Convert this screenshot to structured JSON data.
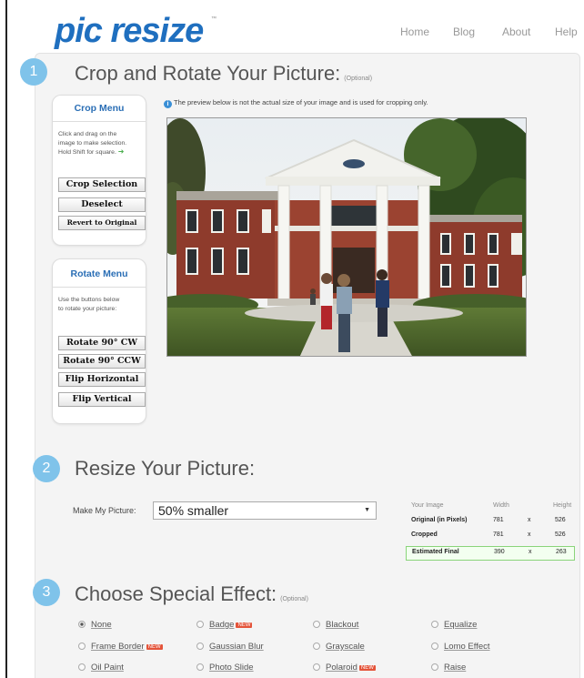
{
  "header": {
    "logo": "pic resize",
    "nav": [
      "Home",
      "Blog",
      "About",
      "Help"
    ]
  },
  "steps": [
    {
      "number": "1",
      "title": "Crop and Rotate Your Picture:",
      "optional": "(Optional)"
    },
    {
      "number": "2",
      "title": "Resize Your Picture:",
      "optional": ""
    },
    {
      "number": "3",
      "title": "Choose Special Effect:",
      "optional": "(Optional)"
    }
  ],
  "crop_menu": {
    "title": "Crop Menu",
    "desc_line1": "Click and drag on the",
    "desc_line2": "image to make selection.",
    "desc_line3": "Hold Shift for square.",
    "buttons": [
      "Crop Selection",
      "Deselect",
      "Revert to Original"
    ]
  },
  "rotate_menu": {
    "title": "Rotate Menu",
    "desc_line1": "Use the buttons below",
    "desc_line2": "to rotate your picture:",
    "buttons": [
      "Rotate 90° CW",
      "Rotate 90° CCW",
      "Flip Horizontal",
      "Flip Vertical"
    ]
  },
  "preview_notice": "The preview below is not the actual size of your image and is used for cropping only.",
  "resize": {
    "label": "Make My Picture:",
    "selected": "50% smaller"
  },
  "dimensions": {
    "headers": [
      "Your Image",
      "Width",
      "Height"
    ],
    "rows": [
      {
        "label": "Original (in Pixels)",
        "width": "781",
        "x": "x",
        "height": "526"
      },
      {
        "label": "Cropped",
        "width": "781",
        "x": "x",
        "height": "526"
      },
      {
        "label": "Estimated Final",
        "width": "390",
        "x": "x",
        "height": "263"
      }
    ]
  },
  "effects": [
    {
      "label": "None",
      "selected": true,
      "new": false
    },
    {
      "label": "Badge",
      "selected": false,
      "new": true
    },
    {
      "label": "Blackout",
      "selected": false,
      "new": false
    },
    {
      "label": "Equalize",
      "selected": false,
      "new": false
    },
    {
      "label": "Frame Border",
      "selected": false,
      "new": true
    },
    {
      "label": "Gaussian Blur",
      "selected": false,
      "new": false
    },
    {
      "label": "Grayscale",
      "selected": false,
      "new": false
    },
    {
      "label": "Lomo Effect",
      "selected": false,
      "new": false
    },
    {
      "label": "Oil Paint",
      "selected": false,
      "new": false
    },
    {
      "label": "Photo Slide",
      "selected": false,
      "new": false
    },
    {
      "label": "Polaroid",
      "selected": false,
      "new": true
    },
    {
      "label": "Raise",
      "selected": false,
      "new": false
    }
  ],
  "new_badge_text": "NEW",
  "colors": {
    "brand": "#1f6fbf",
    "step_circle": "#7fc3ea",
    "new_badge": "#e4543a",
    "final_highlight": "#8ad47a"
  }
}
